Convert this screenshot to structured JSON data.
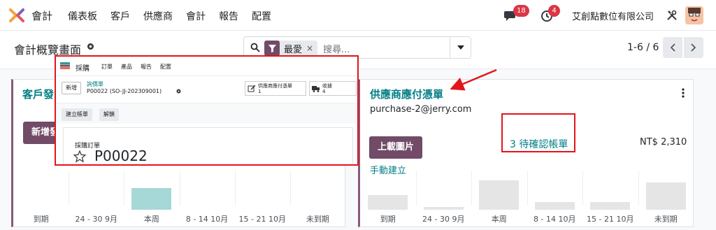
{
  "navbar": {
    "app_name": "會計",
    "menu": [
      "儀表板",
      "客戶",
      "供應商",
      "會計",
      "報告",
      "配置"
    ],
    "messages_count": "18",
    "activities_count": "4",
    "company": "艾創點數位有限公司"
  },
  "control": {
    "title": "會計概覽畫面",
    "facet": "最愛",
    "facet_remove": "×",
    "search_placeholder": "搜尋...",
    "pager": "1-6 / 6"
  },
  "cards": {
    "left": {
      "title": "客戶發",
      "button": "新增發",
      "chart_labels": [
        "到期",
        "24 - 30 9月",
        "本周",
        "8 - 14 10月",
        "15 - 21 10月",
        "未到期"
      ],
      "bar_fill": [
        0,
        0,
        0.55,
        0,
        0,
        0
      ],
      "bar_colors": [
        "#e9ecef",
        "#e9ecef",
        "#a5d8d7",
        "#e9ecef",
        "#e9ecef",
        "#e9ecef"
      ]
    },
    "right": {
      "title": "供應商應付憑單",
      "email": "purchase-2@jerry.com",
      "button": "上載圖片",
      "pending": "3 待確認帳單",
      "amount": "NT$ 2,310",
      "manual": "手動建立",
      "chart_labels": [
        "到期",
        "24 - 30 9月",
        "本周",
        "8 - 14 10月",
        "15 - 21 10月",
        "未到期"
      ],
      "bar_fill": [
        0.38,
        0.08,
        0.75,
        0.2,
        0.2,
        0.7
      ],
      "bar_colors": [
        "#e5e5e5",
        "#e5e5e5",
        "#e5e5e5",
        "#e5e5e5",
        "#e5e5e5",
        "#e5e5e5"
      ]
    }
  },
  "inset": {
    "app": "採購",
    "menu": [
      "訂單",
      "產品",
      "報告",
      "配置"
    ],
    "new_button": "新增",
    "crumb_parent": "詢價單",
    "crumb_current": "P00022 (SO-JJ-202309001)",
    "smart_bill_label": "供應商應付憑單",
    "smart_bill_count": "1",
    "smart_receipt_label": "收據",
    "smart_receipt_count": "4",
    "btn_create_bill": "建立帳單",
    "btn_unlock": "解鎖",
    "sheet_label": "採購訂單",
    "order_ref": "P00022"
  },
  "colors": {
    "brand": "#714b67",
    "link": "#017e84",
    "annotation": "#e3151a",
    "badge": "#dc3545"
  }
}
